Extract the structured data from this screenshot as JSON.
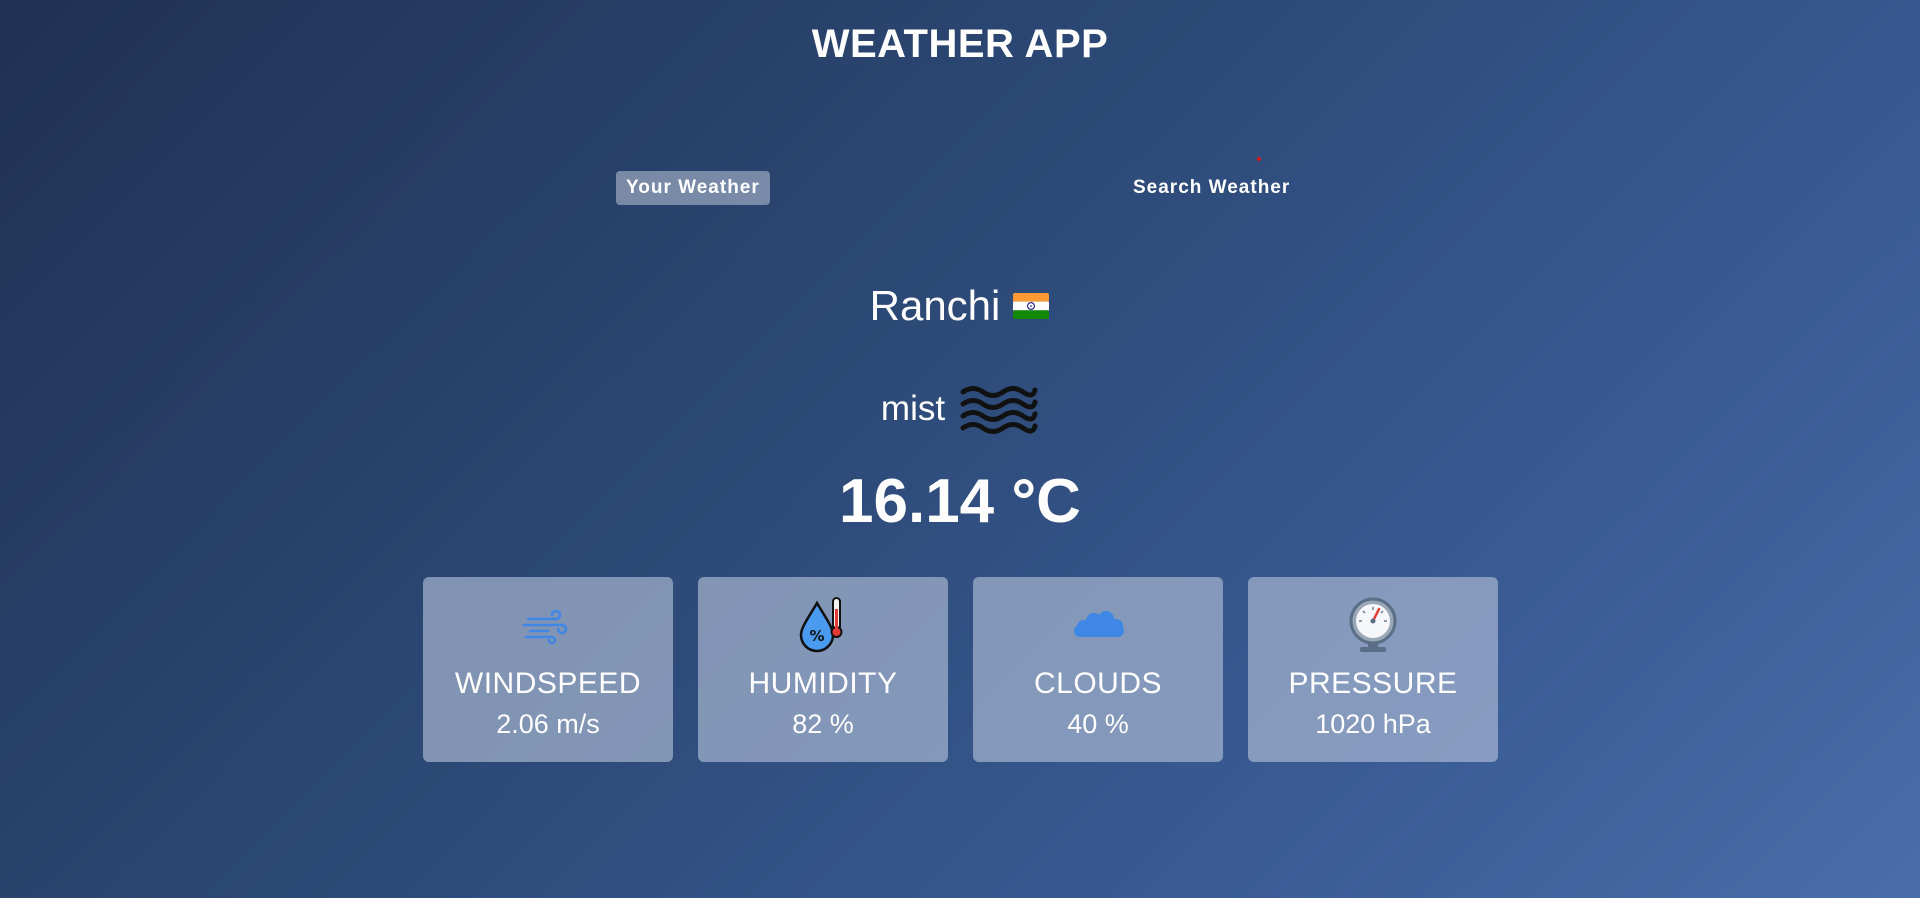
{
  "header": {
    "title": "WEATHER APP"
  },
  "tabs": {
    "your_weather": "Your Weather",
    "search_weather": "Search Weather"
  },
  "location": {
    "city": "Ranchi",
    "flag_icon": "india-flag-icon"
  },
  "weather": {
    "description": "mist",
    "description_icon": "mist-icon",
    "temperature": "16.14 °C"
  },
  "cards": [
    {
      "icon": "wind-icon",
      "label": "WINDSPEED",
      "value": "2.06 m/s"
    },
    {
      "icon": "humidity-icon",
      "label": "HUMIDITY",
      "value": "82 %"
    },
    {
      "icon": "cloud-icon",
      "label": "CLOUDS",
      "value": "40 %"
    },
    {
      "icon": "pressure-gauge-icon",
      "label": "PRESSURE",
      "value": "1020 hPa"
    }
  ],
  "colors": {
    "background_start": "#1f3152",
    "background_end": "#4a6ea8",
    "card_background": "#afbdd6",
    "text": "#ffffff",
    "accent_icon": "#3f87e6"
  }
}
